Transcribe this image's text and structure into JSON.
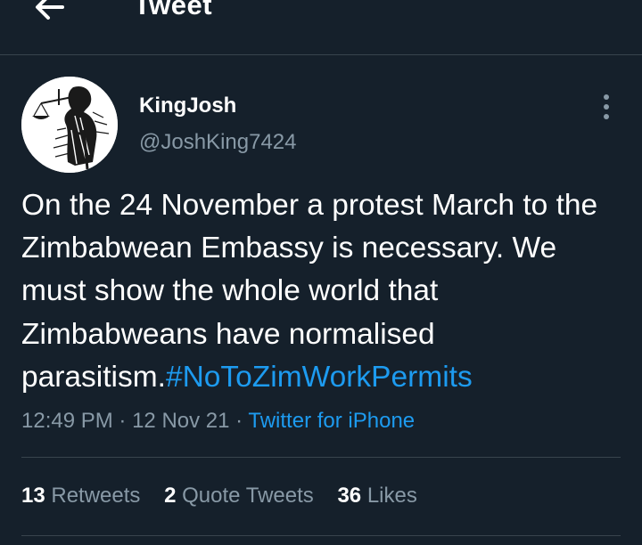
{
  "topbar": {
    "title": "Tweet"
  },
  "tweet": {
    "author": {
      "display_name": "KingJosh",
      "handle": "@JoshKing7424"
    },
    "text": "On the 24 November a protest March to the Zimbabwean Embassy is necessary. We must show the whole world that Zimbabweans have normalised parasitism.",
    "hashtag": "#NoToZimWorkPermits",
    "time": "12:49 PM",
    "date": "12 Nov 21",
    "separator": "·",
    "source": "Twitter for iPhone"
  },
  "stats": {
    "retweets": {
      "count": "13",
      "label": "Retweets"
    },
    "quote_tweets": {
      "count": "2",
      "label": "Quote Tweets"
    },
    "likes": {
      "count": "36",
      "label": "Likes"
    }
  },
  "icons": {
    "back": "back-arrow-icon",
    "more": "more-vertical-icon",
    "avatar": "justice-statue-avatar"
  },
  "colors": {
    "background": "#15202b",
    "divider": "#38444d",
    "secondary_text": "#8899a6",
    "link": "#1d9bf0"
  }
}
